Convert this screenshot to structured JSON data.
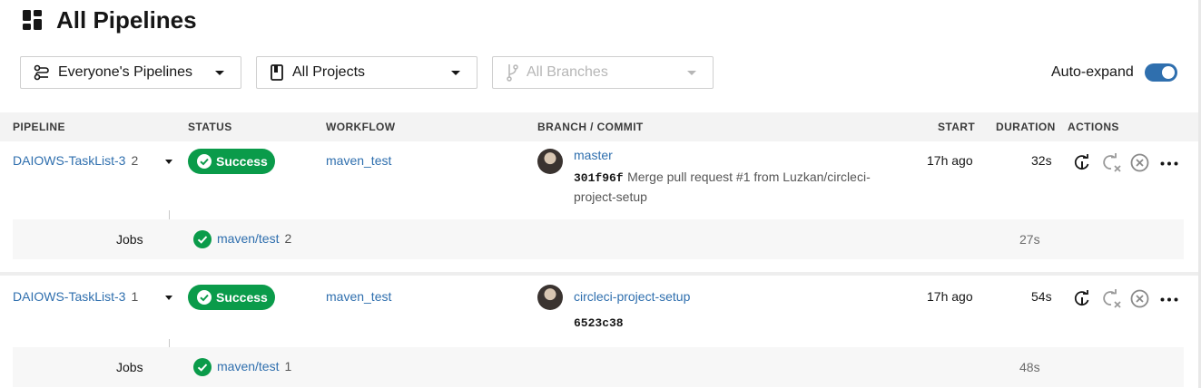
{
  "page": {
    "title": "All Pipelines"
  },
  "filters": {
    "pipelines": "Everyone's Pipelines",
    "projects": "All Projects",
    "branches": "All Branches"
  },
  "auto_expand": {
    "label": "Auto-expand",
    "enabled": true
  },
  "columns": {
    "pipeline": "PIPELINE",
    "status": "STATUS",
    "workflow": "WORKFLOW",
    "branch": "BRANCH / COMMIT",
    "start": "START",
    "duration": "DURATION",
    "actions": "ACTIONS"
  },
  "pipelines": [
    {
      "project": "DAIOWS-TaskList-3",
      "number": "2",
      "status": "Success",
      "workflow": "maven_test",
      "branch": "master",
      "commit_sha": "301f96f",
      "commit_msg_line1": "Merge pull request #1 from Luzkan/circleci-",
      "commit_msg_line2": "project-setup",
      "start": "17h ago",
      "duration": "32s",
      "jobs_label": "Jobs",
      "job_name": "maven/test",
      "job_number": "2",
      "job_duration": "27s"
    },
    {
      "project": "DAIOWS-TaskList-3",
      "number": "1",
      "status": "Success",
      "workflow": "maven_test",
      "branch": "circleci-project-setup",
      "commit_sha": "6523c38",
      "commit_msg_line1": "",
      "commit_msg_line2": "",
      "start": "17h ago",
      "duration": "54s",
      "jobs_label": "Jobs",
      "job_name": "maven/test",
      "job_number": "1",
      "job_duration": "48s"
    }
  ],
  "colors": {
    "accent": "#2f6fae",
    "success": "#0a9b4a"
  },
  "icons": [
    "dashboard-icon",
    "pipelines-filter-icon",
    "project-icon",
    "branch-icon",
    "rerun-icon",
    "rerun-failed-icon",
    "cancel-icon",
    "more-icon",
    "check-icon"
  ]
}
